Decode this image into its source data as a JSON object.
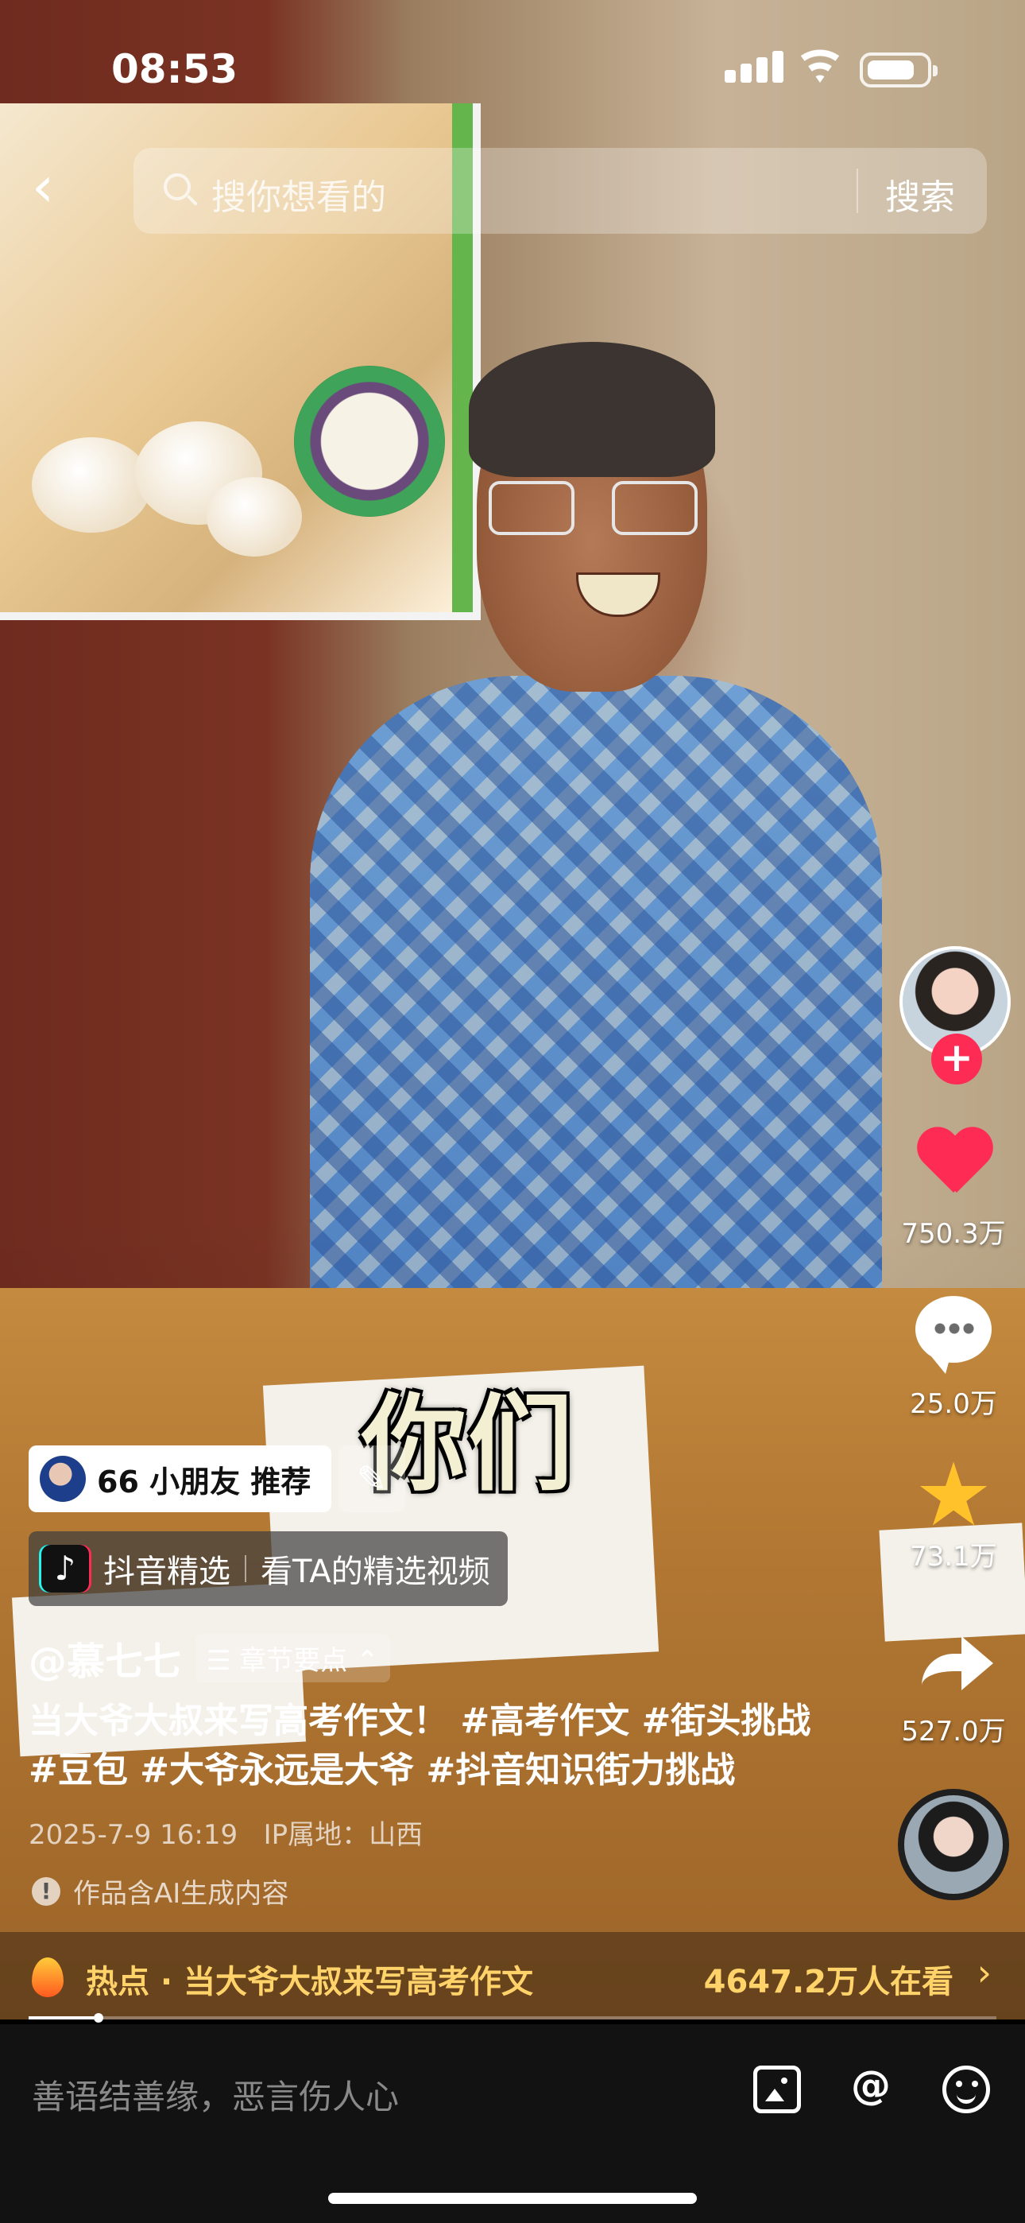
{
  "status_bar": {
    "time": "08:53"
  },
  "search": {
    "placeholder": "搜你想看的",
    "button": "搜索"
  },
  "video": {
    "subtitle": "你们"
  },
  "actions": {
    "likes": "750.3万",
    "comments": "25.0万",
    "favorites": "73.1万",
    "shares": "527.0万"
  },
  "recommend": {
    "text": "66 小朋友  推荐"
  },
  "selection": {
    "brand": "抖音精选",
    "link": "看TA的精选视频"
  },
  "author": {
    "name": "@慕七七",
    "chapters": "☰ 章节要点 ⌃"
  },
  "description": "当大爷大叔来写高考作文！ #高考作文 #街头挑战 #豆包 #大爷永远是大爷 #抖音知识街力挑战",
  "meta": {
    "date": "2025-7-9 16:19",
    "ip": "IP属地：山西"
  },
  "ai_notice": "作品含AI生成内容",
  "hot": {
    "text": "热点 · 当大爷大叔来写高考作文",
    "viewers": "4647.2万人在看"
  },
  "progress": 0.072,
  "comment": {
    "placeholder": "善语结善缘，恶言伤人心"
  },
  "icons": {
    "back": "chevron-left-icon",
    "search": "search-icon",
    "follow": "plus-icon",
    "like": "heart-icon",
    "comment": "comment-icon",
    "favorite": "star-icon",
    "share": "share-icon",
    "image": "image-icon",
    "mention": "at-icon",
    "emoji": "emoji-icon"
  }
}
